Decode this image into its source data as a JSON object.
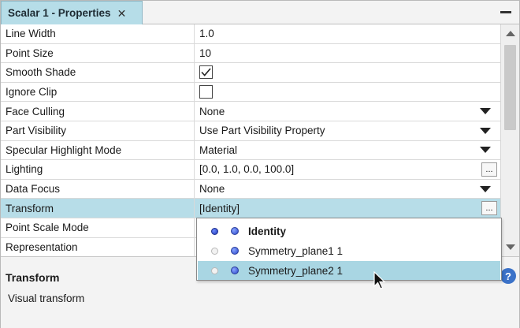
{
  "panel": {
    "tab_title": "Scalar 1 - Properties",
    "close_glyph": "✕"
  },
  "properties": [
    {
      "name": "Line Width",
      "value": "1.0",
      "kind": "text"
    },
    {
      "name": "Point Size",
      "value": "10",
      "kind": "text"
    },
    {
      "name": "Smooth Shade",
      "value": "",
      "kind": "checkbox",
      "checked": true
    },
    {
      "name": "Ignore Clip",
      "value": "",
      "kind": "checkbox",
      "checked": false
    },
    {
      "name": "Face Culling",
      "value": "None",
      "kind": "dropdown"
    },
    {
      "name": "Part Visibility",
      "value": "Use Part Visibility Property",
      "kind": "dropdown"
    },
    {
      "name": "Specular Highlight Mode",
      "value": "Material",
      "kind": "dropdown"
    },
    {
      "name": "Lighting",
      "value": "[0.0, 1.0, 0.0, 100.0]",
      "kind": "ellipsis"
    },
    {
      "name": "Data Focus",
      "value": "None",
      "kind": "dropdown"
    },
    {
      "name": "Transform",
      "value": "[Identity]",
      "kind": "ellipsis",
      "selected": true
    },
    {
      "name": "Point Scale Mode",
      "value": "",
      "kind": "text"
    },
    {
      "name": "Representation",
      "value": "",
      "kind": "text"
    }
  ],
  "ellipsis_label": "...",
  "transform_popup": {
    "items": [
      {
        "label": "Identity",
        "first_on": true,
        "bold": true,
        "hover": false
      },
      {
        "label": "Symmetry_plane1 1",
        "first_on": false,
        "bold": false,
        "hover": false
      },
      {
        "label": "Symmetry_plane2 1",
        "first_on": false,
        "bold": false,
        "hover": true
      }
    ]
  },
  "description": {
    "title": "Transform",
    "text": "Visual transform",
    "help_glyph": "?"
  },
  "colors": {
    "selection": "#b7dde8",
    "tab": "#b6dde8",
    "help": "#3b72c8"
  }
}
